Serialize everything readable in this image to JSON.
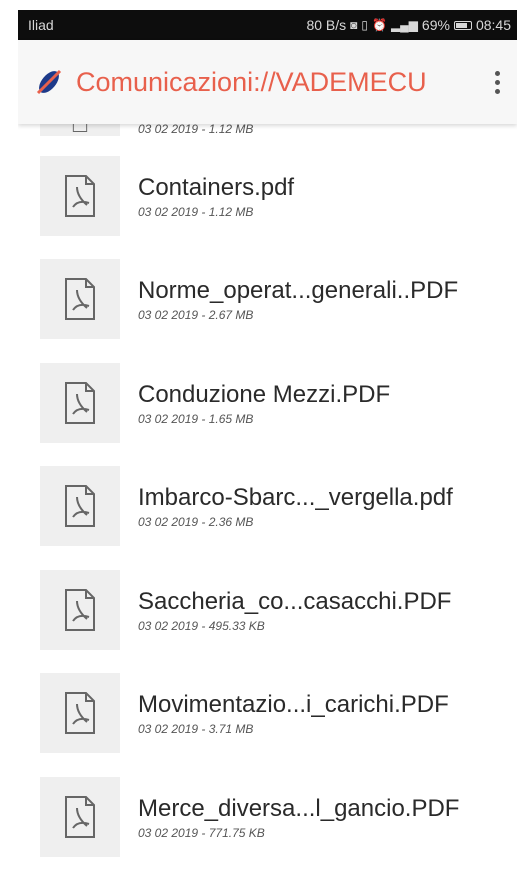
{
  "status_bar": {
    "carrier": "Iliad",
    "speed": "80 B/s",
    "battery_percent": "69%",
    "time": "08:45",
    "battery_level": 0.69
  },
  "app_bar": {
    "title": "Comunicazioni://VADEMECU",
    "logo_icon": "pen-logo-icon",
    "menu_icon": "more-vert-icon",
    "title_color": "#e8604c"
  },
  "files": [
    {
      "name": "",
      "meta": "03 02 2019 - 1.12 MB"
    },
    {
      "name": "Containers.pdf",
      "meta": "03 02 2019 - 1.12 MB"
    },
    {
      "name": "Norme_operat...generali..PDF",
      "meta": "03 02 2019 - 2.67 MB"
    },
    {
      "name": "Conduzione Mezzi.PDF",
      "meta": "03 02 2019 - 1.65 MB"
    },
    {
      "name": "Imbarco-Sbarc..._vergella.pdf",
      "meta": "03 02 2019 - 2.36 MB"
    },
    {
      "name": "Saccheria_co...casacchi.PDF",
      "meta": "03 02 2019 - 495.33 KB"
    },
    {
      "name": "Movimentazio...i_carichi.PDF",
      "meta": "03 02 2019 - 3.71 MB"
    },
    {
      "name": "Merce_diversa...l_gancio.PDF",
      "meta": "03 02 2019 - 771.75 KB"
    }
  ]
}
